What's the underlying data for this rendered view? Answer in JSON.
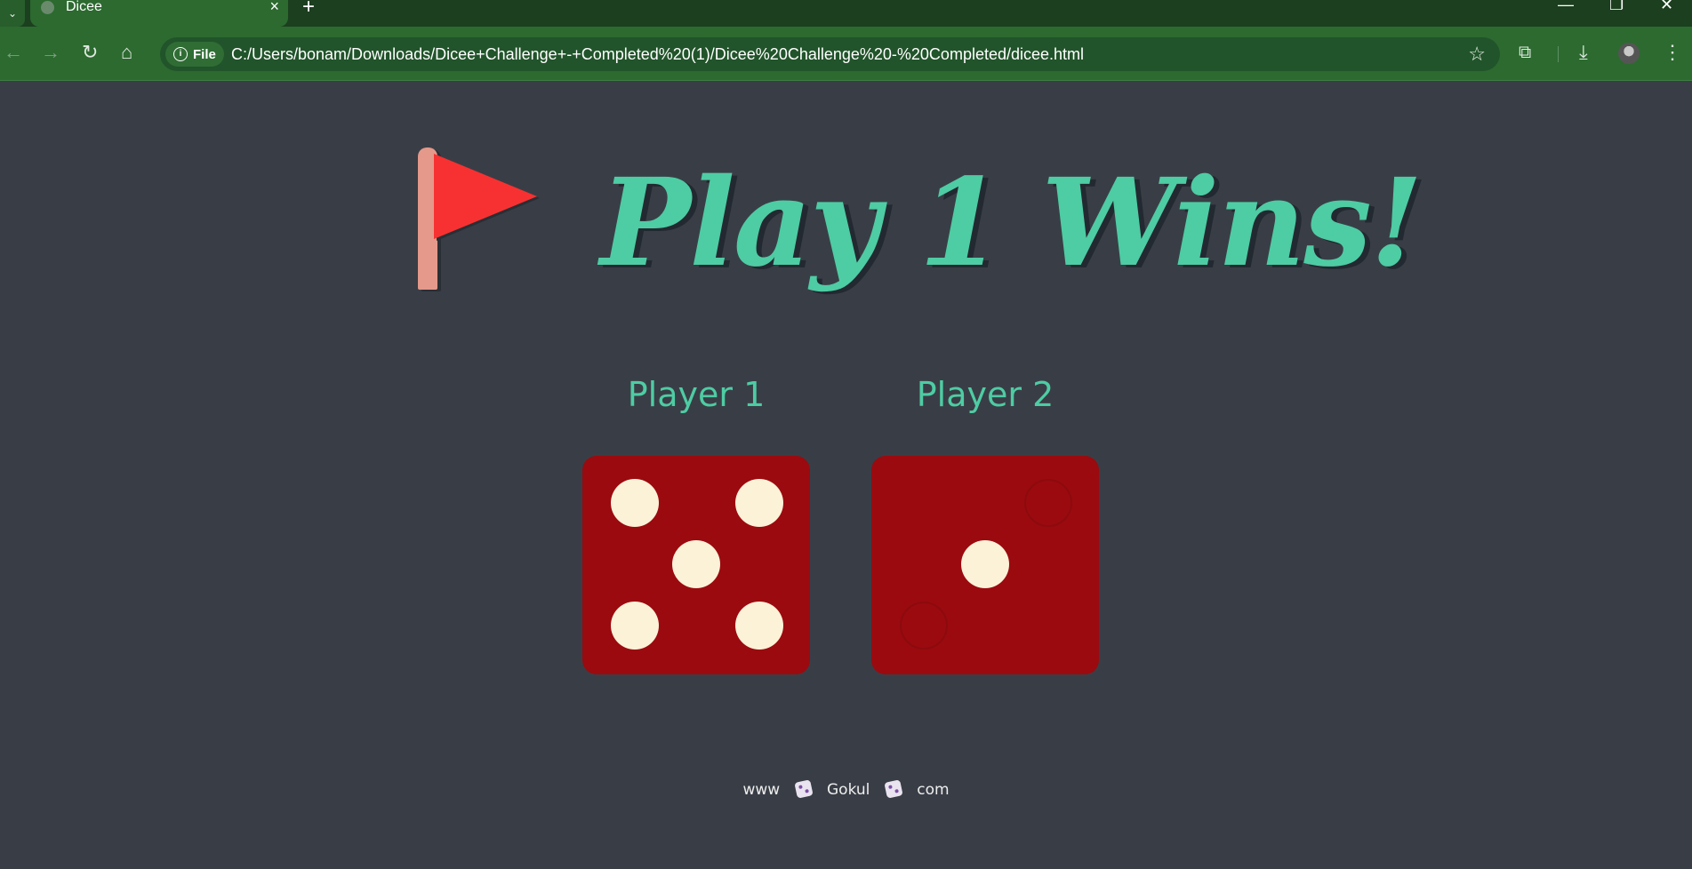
{
  "browser": {
    "tab_list_icon": "chevron-down-icon",
    "tab_title": "Dicee",
    "tab_close": "×",
    "new_tab": "+",
    "window_controls": {
      "minimize": "—",
      "restore": "❐",
      "close": "✕"
    },
    "back": "←",
    "forward": "→",
    "reload": "↻",
    "home": "⌂",
    "site_chip": "File",
    "url": "C:/Users/bonam/Downloads/Dicee+Challenge+-+Completed%20(1)/Dicee%20Challenge%20-%20Completed/dicee.html",
    "bookmark_star": "☆",
    "extensions": "⧉",
    "download": "⤓",
    "menu": "⋮"
  },
  "page": {
    "title": "Play 1 Wins!",
    "flag_icon": "red-flag-icon",
    "players": [
      {
        "label": "Player 1",
        "die_value": 5
      },
      {
        "label": "Player 2",
        "die_value": 1
      }
    ],
    "footer": {
      "part1": "www",
      "part2": "Gokul",
      "part3": "com"
    }
  },
  "colors": {
    "background": "#393E46",
    "accent": "#4ECCA3",
    "die": "#9B0A0F",
    "pip": "#FBF2D8",
    "flag": "#F73131",
    "browser_chrome": "#2C6A30"
  }
}
